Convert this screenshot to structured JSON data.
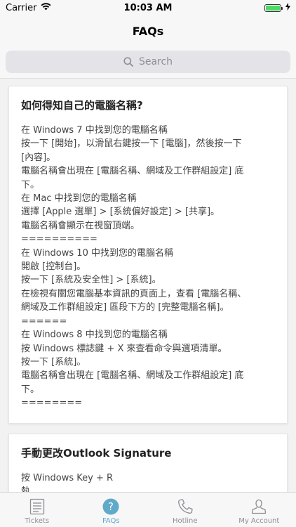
{
  "status": {
    "carrier": "Carrier",
    "time": "10:03 AM"
  },
  "nav": {
    "title": "FAQs"
  },
  "search": {
    "placeholder": "Search"
  },
  "faqs": [
    {
      "title": "如何得知自己的電腦名稱?",
      "lines": [
        "在 Windows 7 中找到您的電腦名稱",
        "按一下 [開始]，以滑鼠右鍵按一下 [電腦]，然後按一下",
        "[內容]。",
        "電腦名稱會出現在 [電腦名稱、網域及工作群組設定] 底",
        "下。",
        "在 Mac 中找到您的電腦名稱",
        "選擇 [Apple 選單] > [系統偏好設定] > [共享]。",
        "電腦名稱會顯示在視窗頂端。",
        "==========",
        "在 Windows 10 中找到您的電腦名稱",
        "開啟 [控制台]。",
        "按一下 [系統及安全性] > [系統]。",
        "在檢視有關您電腦基本資訊的頁面上，查看 [電腦名稱、",
        "網域及工作群組設定] 區段下方的 [完整電腦名稱]。",
        "======",
        "在 Windows 8 中找到您的電腦名稱",
        "按 Windows 標誌鍵 + X 來查看命令與選項清單。",
        "按一下 [系統]。",
        "電腦名稱會出現在 [電腦名稱、網域及工作群組設定] 底",
        "下。",
        "========"
      ]
    },
    {
      "title": "手動更改Outlook Signature",
      "lines": [
        "按 Windows Key + R",
        "執"
      ]
    }
  ],
  "tabs": [
    {
      "label": "Tickets",
      "icon": "list-icon",
      "active": false
    },
    {
      "label": "FAQs",
      "icon": "question-icon",
      "active": true
    },
    {
      "label": "Hotline",
      "icon": "phone-icon",
      "active": false
    },
    {
      "label": "My Account",
      "icon": "person-icon",
      "active": false
    }
  ],
  "colors": {
    "accent": "#5fa9c9",
    "inactive": "#8e8e93",
    "battery": "#4cd964"
  }
}
